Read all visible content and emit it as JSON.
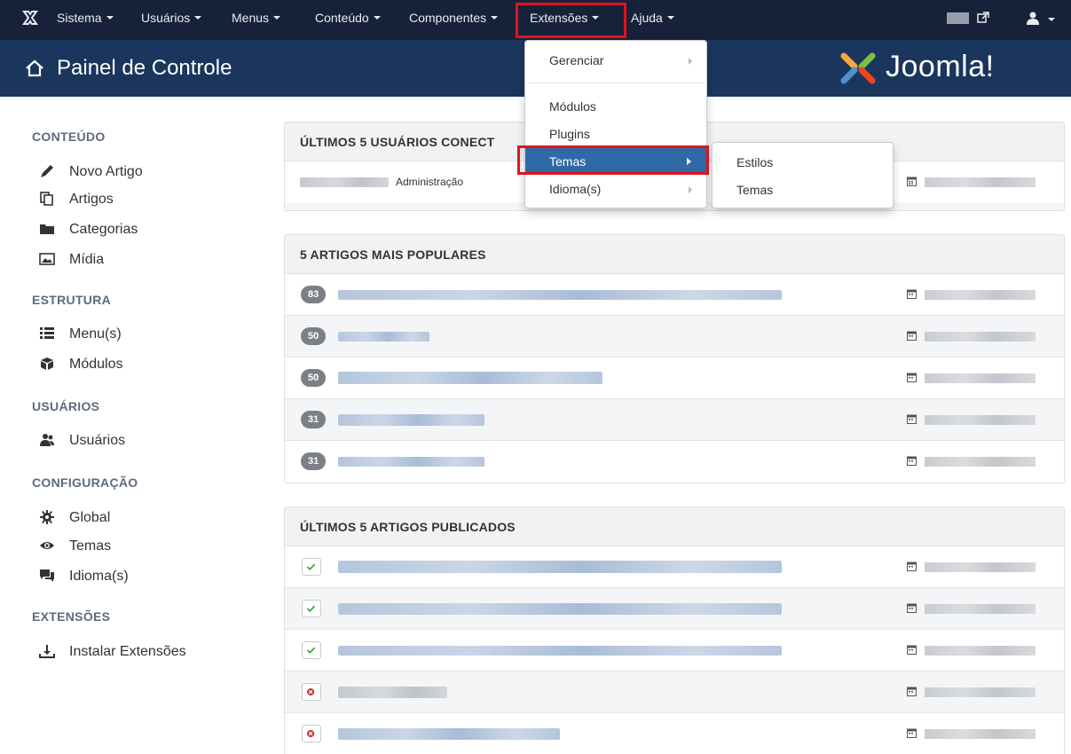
{
  "navbar": {
    "items": [
      {
        "label": "Sistema"
      },
      {
        "label": "Usuários"
      },
      {
        "label": "Menus"
      },
      {
        "label": "Conteúdo"
      },
      {
        "label": "Componentes"
      },
      {
        "label": "Extensões"
      },
      {
        "label": "Ajuda"
      }
    ]
  },
  "header": {
    "title": "Painel de Controle",
    "logo_text": "Joomla!"
  },
  "sidebar": {
    "sections": [
      {
        "heading": "CONTEÚDO",
        "items": [
          {
            "label": "Novo Artigo",
            "icon": "pencil-icon"
          },
          {
            "label": "Artigos",
            "icon": "copy-icon"
          },
          {
            "label": "Categorias",
            "icon": "folder-icon"
          },
          {
            "label": "Mídia",
            "icon": "image-icon"
          }
        ]
      },
      {
        "heading": "ESTRUTURA",
        "items": [
          {
            "label": "Menu(s)",
            "icon": "list-icon"
          },
          {
            "label": "Módulos",
            "icon": "cube-icon"
          }
        ]
      },
      {
        "heading": "USUÁRIOS",
        "items": [
          {
            "label": "Usuários",
            "icon": "users-icon"
          }
        ]
      },
      {
        "heading": "CONFIGURAÇÃO",
        "items": [
          {
            "label": "Global",
            "icon": "cog-icon"
          },
          {
            "label": "Temas",
            "icon": "eye-icon"
          },
          {
            "label": "Idioma(s)",
            "icon": "comments-icon"
          }
        ]
      },
      {
        "heading": "EXTENSÕES",
        "items": [
          {
            "label": "Instalar Extensões",
            "icon": "download-icon"
          }
        ]
      }
    ]
  },
  "panels": {
    "users": {
      "title": "ÚLTIMOS 5 USUÁRIOS CONECT",
      "rows": [
        {
          "location": "Administração"
        }
      ]
    },
    "popular": {
      "title": "5 ARTIGOS MAIS POPULARES",
      "hits": [
        "83",
        "50",
        "50",
        "31",
        "31"
      ]
    },
    "recent": {
      "title": "ÚLTIMOS 5 ARTIGOS PUBLICADOS",
      "status": [
        "published",
        "published",
        "published",
        "unpublished",
        "unpublished"
      ]
    }
  },
  "dropdown": {
    "items": [
      "Gerenciar",
      "Módulos",
      "Plugins",
      "Temas",
      "Idioma(s)"
    ],
    "active": "Temas"
  },
  "submenu": {
    "items": [
      "Estilos",
      "Temas"
    ]
  },
  "colors": {
    "navbar": "#17223a",
    "header": "#1b365c",
    "active_item": "#2f6aa7",
    "highlight_box": "#e1141c"
  }
}
